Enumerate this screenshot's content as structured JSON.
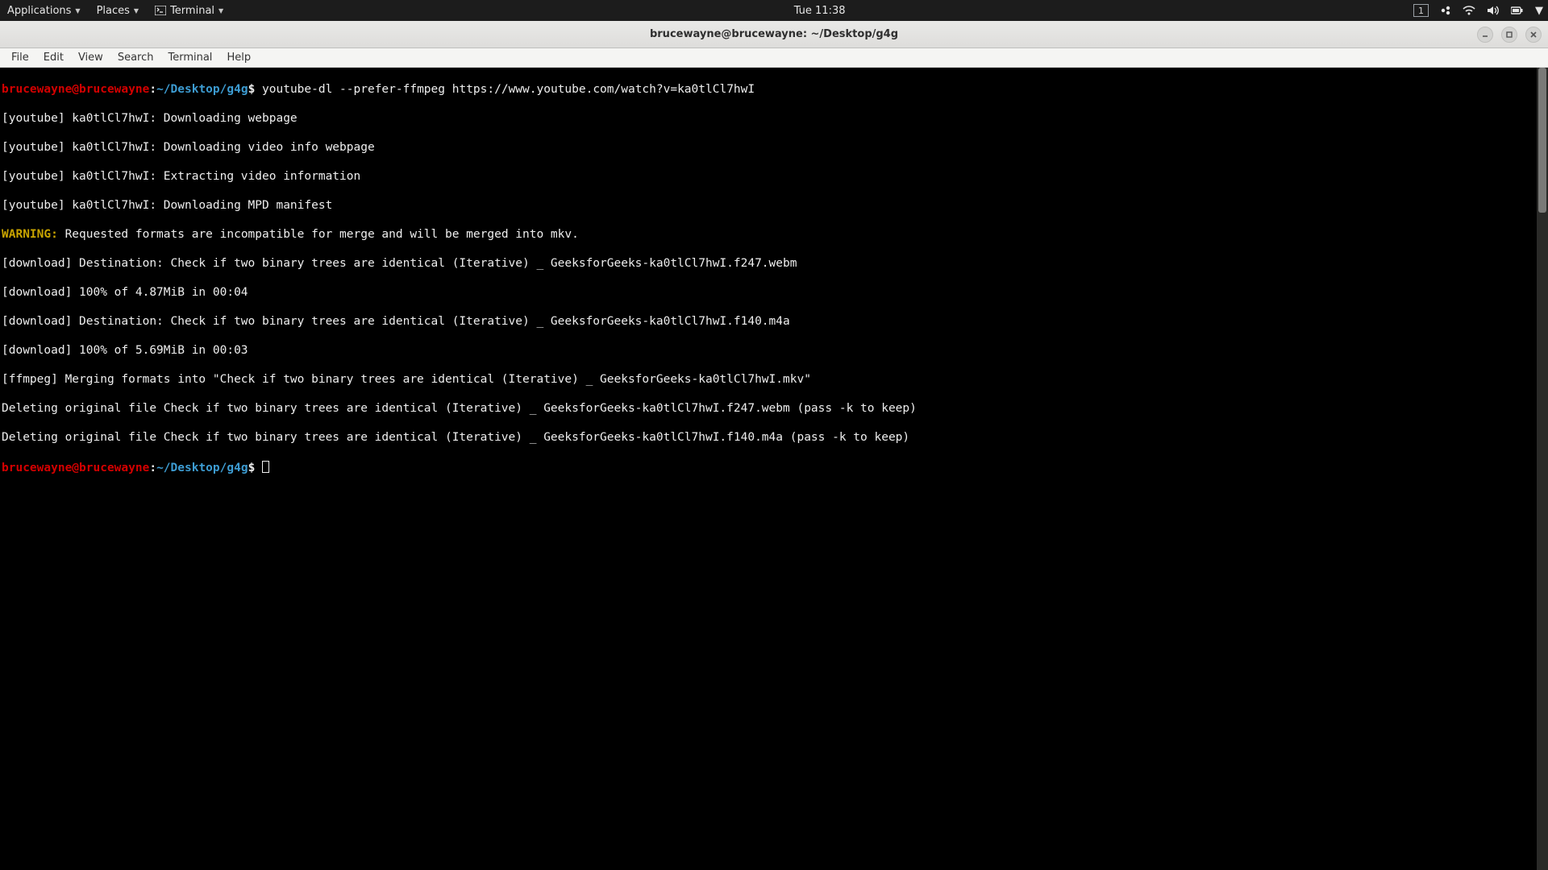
{
  "topbar": {
    "applications": "Applications",
    "places": "Places",
    "terminal": "Terminal",
    "clock": "Tue 11:38",
    "workspace_badge": "1"
  },
  "titlebar": {
    "title": "brucewayne@brucewayne: ~/Desktop/g4g"
  },
  "menubar": {
    "items": [
      "File",
      "Edit",
      "View",
      "Search",
      "Terminal",
      "Help"
    ]
  },
  "prompt": {
    "user": "brucewayne@brucewayne",
    "colon": ":",
    "path": "~/Desktop/g4g",
    "dollar": "$"
  },
  "command": " youtube-dl --prefer-ffmpeg https://www.youtube.com/watch?v=ka0tlCl7hwI",
  "warning_label": "WARNING:",
  "warning_text": " Requested formats are incompatible for merge and will be merged into mkv.",
  "out": [
    "[youtube] ka0tlCl7hwI: Downloading webpage",
    "[youtube] ka0tlCl7hwI: Downloading video info webpage",
    "[youtube] ka0tlCl7hwI: Extracting video information",
    "[youtube] ka0tlCl7hwI: Downloading MPD manifest"
  ],
  "out2": [
    "[download] Destination: Check if two binary trees are identical (Iterative) _ GeeksforGeeks-ka0tlCl7hwI.f247.webm",
    "[download] 100% of 4.87MiB in 00:04",
    "[download] Destination: Check if two binary trees are identical (Iterative) _ GeeksforGeeks-ka0tlCl7hwI.f140.m4a",
    "[download] 100% of 5.69MiB in 00:03",
    "[ffmpeg] Merging formats into \"Check if two binary trees are identical (Iterative) _ GeeksforGeeks-ka0tlCl7hwI.mkv\"",
    "Deleting original file Check if two binary trees are identical (Iterative) _ GeeksforGeeks-ka0tlCl7hwI.f247.webm (pass -k to keep)",
    "Deleting original file Check if two binary trees are identical (Iterative) _ GeeksforGeeks-ka0tlCl7hwI.f140.m4a (pass -k to keep)"
  ]
}
